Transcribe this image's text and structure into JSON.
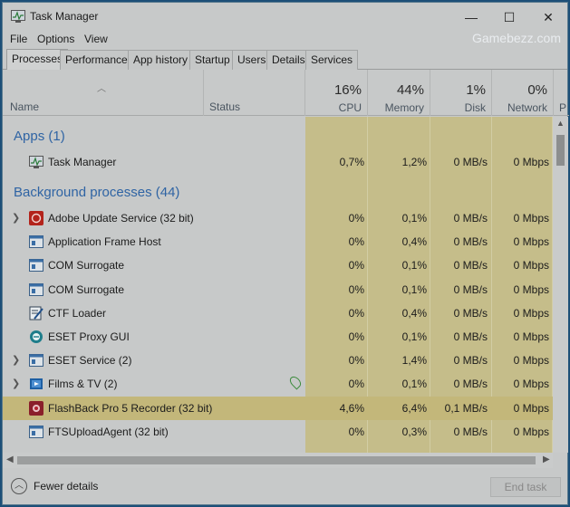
{
  "window": {
    "title": "Task Manager",
    "minimize": "—",
    "maximize": "☐",
    "close": "✕"
  },
  "menu": [
    "File",
    "Options",
    "View"
  ],
  "watermark": "Gamebezz.com",
  "tabs": [
    "Processes",
    "Performance",
    "App history",
    "Startup",
    "Users",
    "Details",
    "Services"
  ],
  "columns": {
    "name": "Name",
    "status": "Status",
    "cpu": {
      "pct": "16%",
      "label": "CPU"
    },
    "memory": {
      "pct": "44%",
      "label": "Memory"
    },
    "disk": {
      "pct": "1%",
      "label": "Disk"
    },
    "network": {
      "pct": "0%",
      "label": "Network"
    },
    "power": "P"
  },
  "groups": {
    "apps": "Apps (1)",
    "background": "Background processes (44)"
  },
  "apps": [
    {
      "name": "Task Manager",
      "cpu": "0,7%",
      "memory": "1,2%",
      "disk": "0 MB/s",
      "network": "0 Mbps",
      "icon": "task-manager-icon"
    }
  ],
  "background": [
    {
      "name": "Adobe Update Service (32 bit)",
      "cpu": "0%",
      "memory": "0,1%",
      "disk": "0 MB/s",
      "network": "0 Mbps",
      "icon": "adobe-icon",
      "expand": true
    },
    {
      "name": "Application Frame Host",
      "cpu": "0%",
      "memory": "0,4%",
      "disk": "0 MB/s",
      "network": "0 Mbps",
      "icon": "window-icon"
    },
    {
      "name": "COM Surrogate",
      "cpu": "0%",
      "memory": "0,1%",
      "disk": "0 MB/s",
      "network": "0 Mbps",
      "icon": "window-icon"
    },
    {
      "name": "COM Surrogate",
      "cpu": "0%",
      "memory": "0,1%",
      "disk": "0 MB/s",
      "network": "0 Mbps",
      "icon": "window-icon"
    },
    {
      "name": "CTF Loader",
      "cpu": "0%",
      "memory": "0,4%",
      "disk": "0 MB/s",
      "network": "0 Mbps",
      "icon": "ctf-icon"
    },
    {
      "name": "ESET Proxy GUI",
      "cpu": "0%",
      "memory": "0,1%",
      "disk": "0 MB/s",
      "network": "0 Mbps",
      "icon": "eset-icon"
    },
    {
      "name": "ESET Service (2)",
      "cpu": "0%",
      "memory": "1,4%",
      "disk": "0 MB/s",
      "network": "0 Mbps",
      "icon": "window-icon",
      "expand": true
    },
    {
      "name": "Films & TV (2)",
      "cpu": "0%",
      "memory": "0,1%",
      "disk": "0 MB/s",
      "network": "0 Mbps",
      "icon": "films-icon",
      "expand": true,
      "leaf": true
    },
    {
      "name": "FlashBack Pro 5 Recorder (32 bit)",
      "cpu": "4,6%",
      "memory": "6,4%",
      "disk": "0,1 MB/s",
      "network": "0 Mbps",
      "icon": "flashback-icon",
      "highlight": true
    },
    {
      "name": "FTSUploadAgent (32 bit)",
      "cpu": "0%",
      "memory": "0,3%",
      "disk": "0 MB/s",
      "network": "0 Mbps",
      "icon": "window-icon"
    }
  ],
  "footer": {
    "fewer_details": "Fewer details",
    "end_task": "End task"
  }
}
